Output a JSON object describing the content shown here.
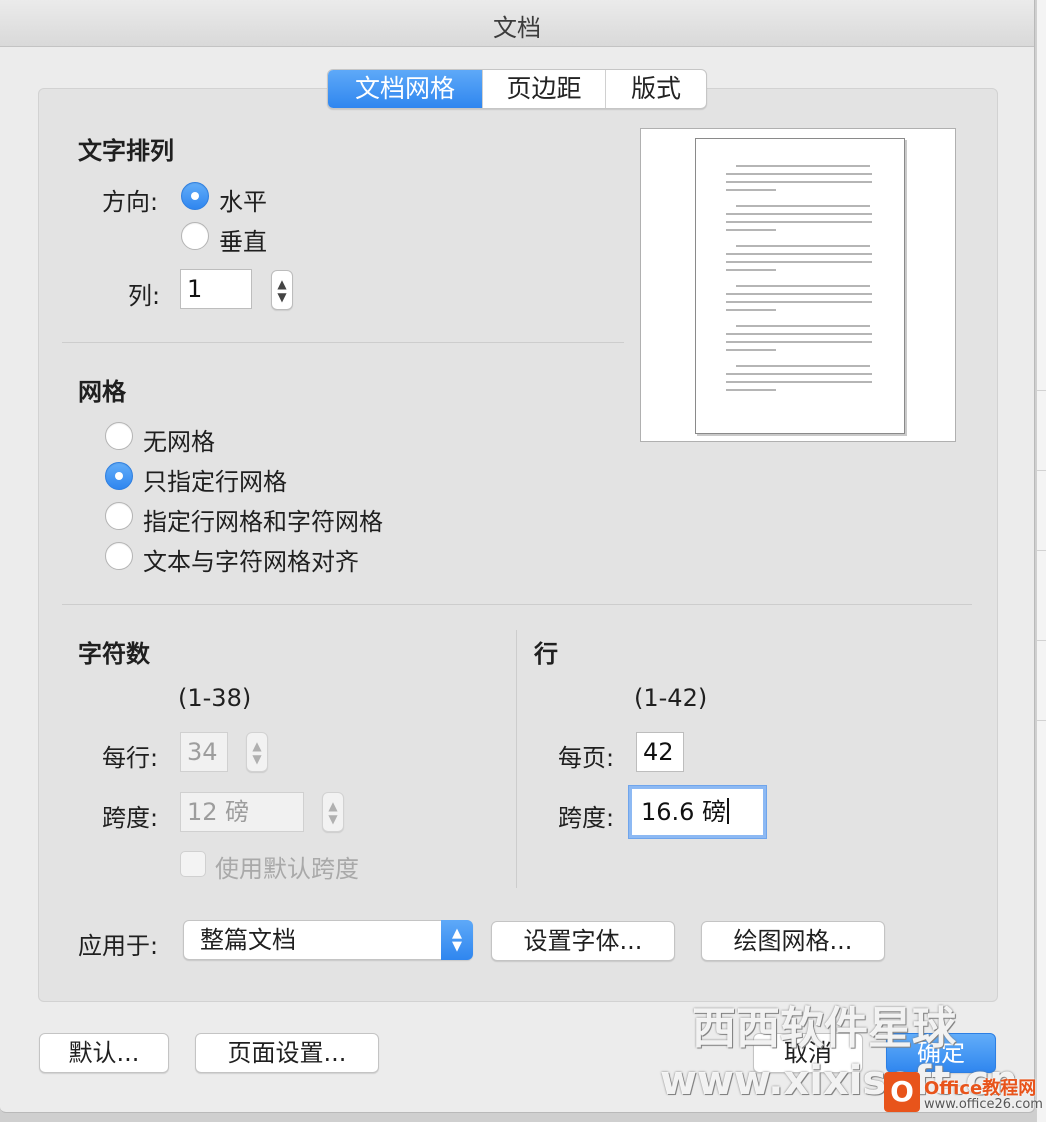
{
  "window": {
    "title": "文档"
  },
  "tabs": [
    {
      "label": "文档网格",
      "active": true
    },
    {
      "label": "页边距",
      "active": false
    },
    {
      "label": "版式",
      "active": false
    }
  ],
  "text_flow": {
    "title": "文字排列",
    "direction_label": "方向:",
    "horizontal_label": "水平",
    "horizontal_selected": true,
    "vertical_label": "垂直",
    "vertical_selected": false,
    "columns_label": "列:",
    "columns_value": "1"
  },
  "grid": {
    "title": "网格",
    "options": [
      {
        "label": "无网格",
        "selected": false
      },
      {
        "label": "只指定行网格",
        "selected": true
      },
      {
        "label": "指定行网格和字符网格",
        "selected": false
      },
      {
        "label": "文本与字符网格对齐",
        "selected": false
      }
    ]
  },
  "characters": {
    "title": "字符数",
    "range": "(1-38)",
    "per_line_label": "每行:",
    "per_line_value": "34",
    "pitch_label": "跨度:",
    "pitch_value": "12 磅",
    "use_default_label": "使用默认跨度"
  },
  "lines": {
    "title": "行",
    "range": "(1-42)",
    "per_page_label": "每页:",
    "per_page_value": "42",
    "pitch_label": "跨度:",
    "pitch_value": "16.6 磅"
  },
  "apply": {
    "label": "应用于:",
    "selected": "整篇文档"
  },
  "buttons": {
    "set_font": "设置字体...",
    "drawing_grid": "绘图网格...",
    "default": "默认...",
    "page_setup": "页面设置...",
    "cancel": "取消",
    "ok": "确定"
  },
  "watermark": {
    "site_cn": "西西软件星球",
    "site_url": "www.xixisoft.cn",
    "office_brand": "Office教程网",
    "office_url": "www.office26.com"
  },
  "colors": {
    "accent": "#2f86ef",
    "background": "#ececec",
    "panel": "#e3e3e3"
  },
  "icons": [
    "stepper-icon",
    "popup-arrows-icon",
    "radio-icon",
    "office-logo-icon"
  ]
}
